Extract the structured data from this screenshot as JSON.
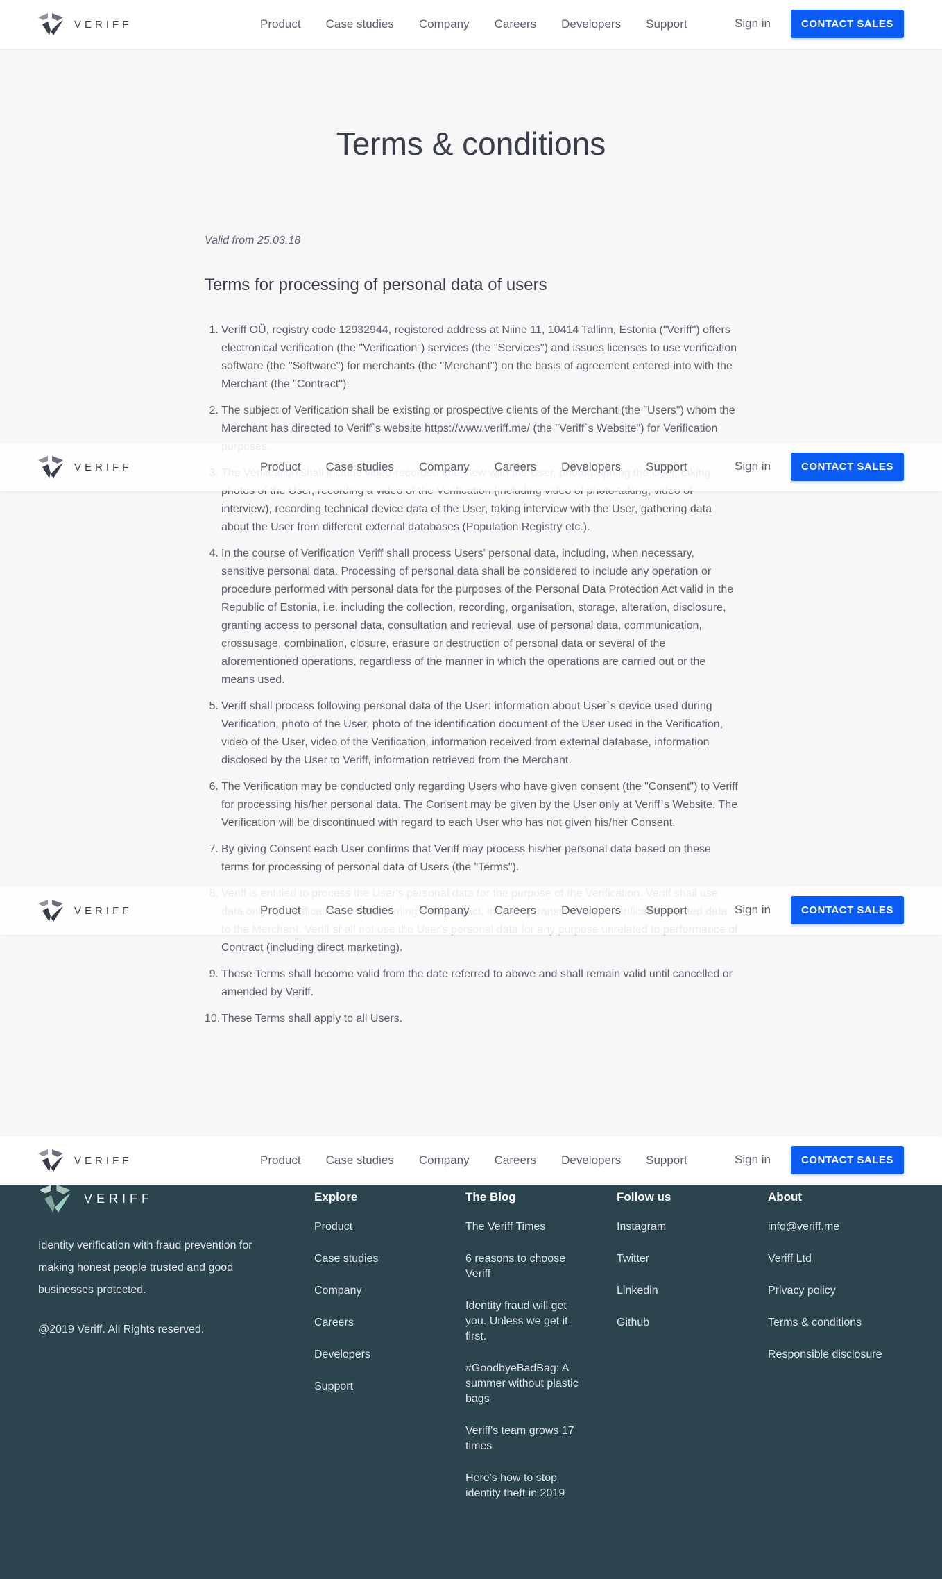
{
  "nav": {
    "brand": "VERIFF",
    "links": [
      "Product",
      "Case studies",
      "Company",
      "Careers",
      "Developers",
      "Support"
    ],
    "sign_in": "Sign in",
    "cta": "CONTACT SALES"
  },
  "main": {
    "title": "Terms & conditions",
    "valid_from": "Valid from 25.03.18",
    "section_title": "Terms for processing of personal data of users",
    "terms": [
      {
        "num": "1.",
        "text": "Veriff OÜ, registry code 12932944, registered address at Niine 11, 10414 Tallinn, Estonia (\"Veriff\") offers electronical verification (the \"Verification\") services (the \"Services\") and issues licenses to use verification software (the \"Software\") for merchants (the \"Merchant\") on the basis of agreement entered into with the Merchant (the \"Contract\")."
      },
      {
        "num": "2.",
        "text": "The subject of Verification shall be existing or prospective clients of the Merchant (the \"Users\") whom the Merchant has directed to Veriff`s website https://www.veriff.me/ (the \"Veriff`s Website\") for Verification purposes."
      },
      {
        "num": "3.",
        "text": "The Verification shall include video-recorded interview with the User, photographing the User, taking photos of the User, recording a video of the Verification (including video of photo-taking, video of interview), recording technical device data of the User, taking interview with the User, gathering data about the User from different external databases (Population Registry etc.)."
      },
      {
        "num": "4.",
        "text": "In the course of Verification Veriff shall process Users' personal data, including, when necessary, sensitive personal data. Processing of personal data shall be considered to include any operation or procedure performed with personal data for the purposes of the Personal Data Protection Act valid in the Republic of Estonia, i.e. including the collection, recording, organisation, storage, alteration, disclosure, granting access to personal data, consultation and retrieval, use of personal data, communication, crossusage, combination, closure, erasure or destruction of personal data or several of the aforementioned operations, regardless of the manner in which the operations are carried out or the means used."
      },
      {
        "num": "5.",
        "text": "Veriff shall process following personal data of the User: information about User`s device used during Verification, photo of the User, photo of the identification document of the User used in the Verification, video of the User, video of the Verification, information received from external database, information disclosed by the User to Veriff, information retrieved from the Merchant."
      },
      {
        "num": "6.",
        "text": "The Verification may be conducted only regarding Users who have given consent (the \"Consent\") to Veriff for processing his/her personal data. The Consent may be given by the User only at Veriff`s Website. The Verification will be discontinued with regard to each User who has not given his/her Consent."
      },
      {
        "num": "7.",
        "text": "By giving Consent each User confirms that Veriff may process his/her personal data based on these terms for processing of personal data of Users (the \"Terms\")."
      },
      {
        "num": "8.",
        "text": "Veriff is entitled to process the User's personal data for the purpose of the Verification. Veriff shall use data only for Verification and performing the Contract, including transmission of verification-related data to the Merchant. Veriff shall not use the User's personal data for any purpose unrelated to performance of Contract (including direct marketing)."
      },
      {
        "num": "9.",
        "text": "These Terms shall become valid from the date referred to above and shall remain valid until cancelled or amended by Veriff."
      },
      {
        "num": "10.",
        "text": "These Terms shall apply to all Users."
      }
    ]
  },
  "footer": {
    "brand": "VERIFF",
    "tagline": "Identity verification with fraud prevention for making honest people trusted and good businesses protected.",
    "copyright": "@2019 Veriff. All Rights reserved.",
    "columns": [
      {
        "title": "Explore",
        "items": [
          "Product",
          "Case studies",
          "Company",
          "Careers",
          "Developers",
          "Support"
        ]
      },
      {
        "title": "The Blog",
        "items": [
          "The Veriff Times",
          "6 reasons to choose Veriff",
          "Identity fraud will get you. Unless we get it first.",
          "#GoodbyeBadBag: A summer without plastic bags",
          "Veriff's team grows 17 times",
          "Here's how to stop identity theft in 2019"
        ]
      },
      {
        "title": "Follow us",
        "items": [
          "Instagram",
          "Twitter",
          "Linkedin",
          "Github"
        ]
      },
      {
        "title": "About",
        "items": [
          "info@veriff.me",
          "Veriff Ltd",
          "Privacy policy",
          "Terms & conditions",
          "Responsible disclosure"
        ]
      }
    ]
  },
  "colors": {
    "accent": "#0a5cf5",
    "footer_bg": "#2c444e",
    "page_bg": "#f7f7f8"
  }
}
